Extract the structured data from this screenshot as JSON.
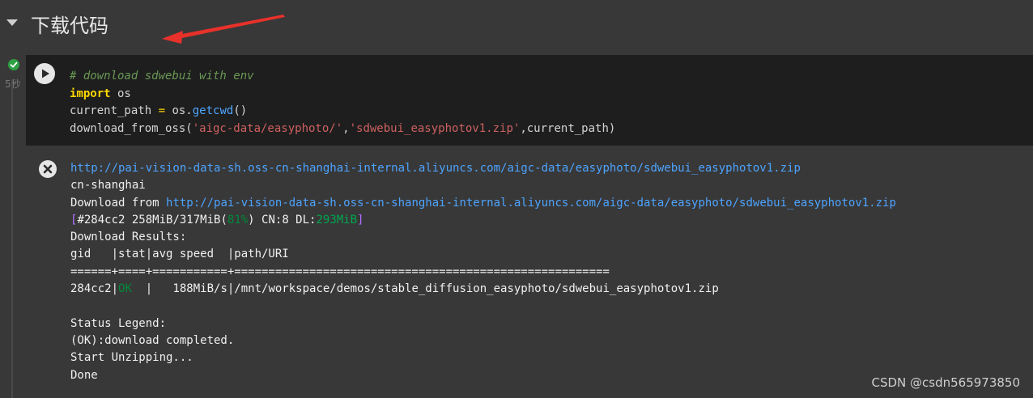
{
  "section": {
    "title": "下载代码"
  },
  "cell": {
    "status": "ok",
    "exec_time": "5秒",
    "code": {
      "line1_comment": "# download sdwebui with env",
      "line2_keyword": "import",
      "line2_rest": " os",
      "line3_var": "current_path",
      "line3_eq": " = ",
      "line3_obj": "os.",
      "line3_func": "getcwd",
      "line3_paren": "()",
      "line4_func": "download_from_oss(",
      "line4_str1": "'aigc-data/easyphoto/'",
      "line4_comma": ",",
      "line4_str2": "'sdwebui_easyphotov1.zip'",
      "line4_end": ",current_path)"
    }
  },
  "output": {
    "url_line": "http://pai-vision-data-sh.oss-cn-shanghai-internal.aliyuncs.com/aigc-data/easyphoto/sdwebui_easyphotov1.zip",
    "region": "cn-shanghai",
    "download_from_label": "Download from ",
    "download_from_url": "http://pai-vision-data-sh.oss-cn-shanghai-internal.aliyuncs.com/aigc-data/easyphoto/sdwebui_easyphotov1.zip",
    "progress_open": "[#284cc2 258MiB/317MiB(",
    "progress_pct": "81%",
    "progress_mid": ") CN:8 DL:",
    "progress_dl": "293MiB",
    "progress_close": "]",
    "results_header": "Download Results:",
    "table_header": "gid   |stat|avg speed  |path/URI",
    "table_sep": "======+====+===========+=======================================================",
    "row_gid": "284cc2",
    "row_sep1": "|",
    "row_stat": "OK",
    "row_rest": "  |   188MiB/s|/mnt/workspace/demos/stable_diffusion_easyphoto/sdwebui_easyphotov1.zip",
    "status_legend": "Status Legend:",
    "ok_legend": "(OK):download completed.",
    "unzipping": "Start Unzipping...",
    "done": "Done"
  },
  "watermark": "CSDN @csdn565973850",
  "colors": {
    "background": "#383838",
    "code_background": "#1e1e1e",
    "annotation_arrow": "#e8312a",
    "ok_green": "#2ea043"
  },
  "icons": {
    "collapse": "caret-down-icon",
    "status": "check-circle-icon",
    "run": "play-icon",
    "clear": "close-circle-icon"
  }
}
